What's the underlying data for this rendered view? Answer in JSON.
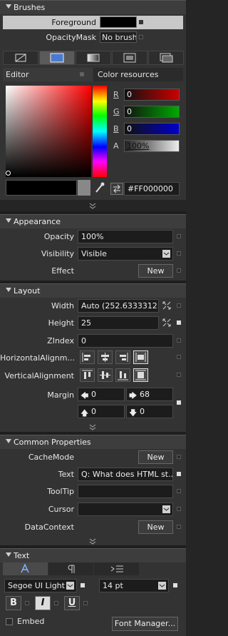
{
  "brushes": {
    "title": "Brushes",
    "foreground_label": "Foreground",
    "opacitymask_label": "OpacityMask",
    "opacitymask_value": "No brush",
    "editor_tab": "Editor",
    "color_resources_tab": "Color resources",
    "r_label": "R",
    "g_label": "G",
    "b_label": "B",
    "a_label": "A",
    "r_value": "0",
    "g_value": "0",
    "b_value": "0",
    "a_value": "100%",
    "hex_value": "#FF000000"
  },
  "appearance": {
    "title": "Appearance",
    "opacity_label": "Opacity",
    "opacity_value": "100%",
    "visibility_label": "Visibility",
    "visibility_value": "Visible",
    "effect_label": "Effect",
    "effect_button": "New"
  },
  "layout": {
    "title": "Layout",
    "width_label": "Width",
    "width_value": "Auto (252.6333312...",
    "height_label": "Height",
    "height_value": "25",
    "zindex_label": "ZIndex",
    "zindex_value": "0",
    "halign_label": "HorizontalAlignm...",
    "valign_label": "VerticalAlignment",
    "margin_label": "Margin",
    "margin_left": "0",
    "margin_right": "68",
    "margin_top": "0",
    "margin_bottom": "0"
  },
  "common": {
    "title": "Common Properties",
    "cachemode_label": "CacheMode",
    "cachemode_button": "New",
    "text_label": "Text",
    "text_value": "Q: What does HTML st...",
    "tooltip_label": "ToolTip",
    "tooltip_value": "",
    "cursor_label": "Cursor",
    "cursor_value": "",
    "datacontext_label": "DataContext",
    "datacontext_button": "New"
  },
  "text": {
    "title": "Text",
    "font_family": "Segoe UI Light",
    "font_size": "14 pt",
    "bold": "B",
    "italic": "I",
    "underline": "U",
    "embed_label": "Embed",
    "font_manager_button": "Font Manager..."
  },
  "colors": {
    "accent_selection": "#e0e0e0",
    "panel": "#333333",
    "field": "#1c1c1c"
  }
}
